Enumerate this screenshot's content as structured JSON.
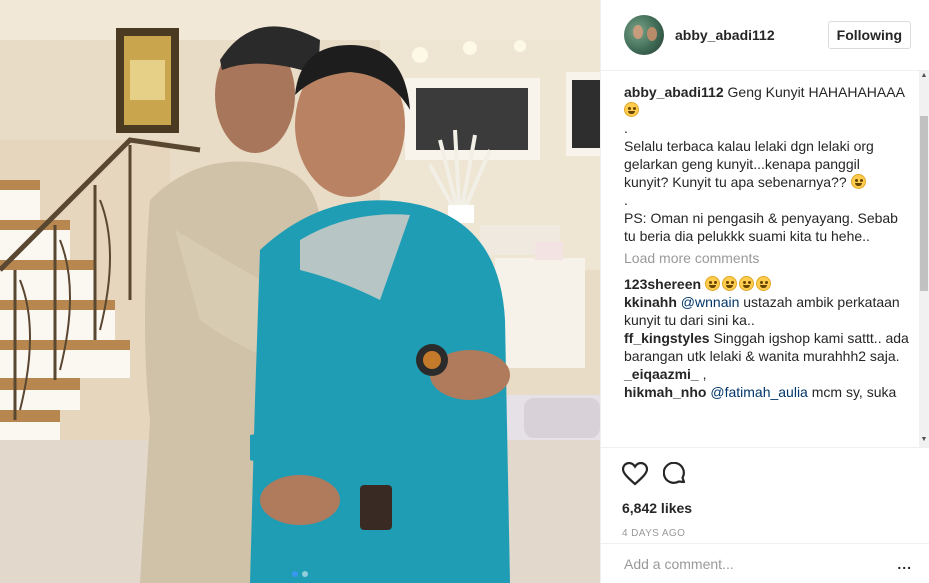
{
  "post": {
    "username": "abby_abadi112",
    "follow_label": "Following",
    "caption": {
      "author": "abby_abadi112",
      "lines": [
        "Geng Kunyit HAHAHAHAAA",
        ".",
        "Selalu terbaca kalau lelaki dgn lelaki org",
        "gelarkan geng kunyit...kenapa panggil",
        "kunyit? Kunyit tu apa sebenarnya??",
        ".",
        "PS: Oman ni pengasih & penyayang. Sebab",
        "tu beria dia pelukkk suami kita tu hehe.."
      ]
    },
    "load_more_label": "Load more comments",
    "comments": [
      {
        "author": "123shereen",
        "mention": "",
        "text": ""
      },
      {
        "author": "kkinahh",
        "mention": "@wnnain",
        "text": " ustazah ambik perkataan kunyit tu dari sini ka.."
      },
      {
        "author": "ff_kingstyles",
        "mention": "",
        "text": " Singgah igshop kami sattt.. ada barangan utk lelaki & wanita murahhh2 saja."
      },
      {
        "author": "_eiqaazmi_",
        "mention": "",
        "text": " ,"
      },
      {
        "author": "hikmah_nho",
        "mention": "@fatimah_aulia",
        "text": " mcm sy, suka"
      }
    ],
    "likes": "6,842 likes",
    "timestamp": "4 DAYS AGO",
    "comment_placeholder": "Add a comment...",
    "more_label": "...",
    "icons": [
      "heart-icon",
      "comment-icon",
      "more-options-icon"
    ],
    "accent_color": "#3897f0",
    "photo": {
      "subject": "two men in baju melayu hugging",
      "carousel_pages": 2,
      "active_page": 1
    }
  }
}
